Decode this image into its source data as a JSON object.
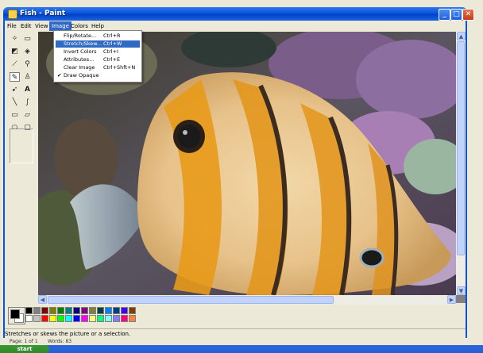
{
  "window": {
    "title": "Fish - Paint"
  },
  "menu": {
    "items": [
      {
        "label": "File"
      },
      {
        "label": "Edit"
      },
      {
        "label": "View"
      },
      {
        "label": "Image",
        "active": true
      },
      {
        "label": "Colors"
      },
      {
        "label": "Help"
      }
    ]
  },
  "image_menu": {
    "items": [
      {
        "label": "Flip/Rotate...",
        "shortcut": "Ctrl+R"
      },
      {
        "label": "Stretch/Skew...",
        "shortcut": "Ctrl+W",
        "highlighted": true
      },
      {
        "label": "Invert Colors",
        "shortcut": "Ctrl+I"
      },
      {
        "label": "Attributes...",
        "shortcut": "Ctrl+E"
      },
      {
        "label": "Clear Image",
        "shortcut": "Ctrl+Shft+N"
      },
      {
        "label": "Draw Opaque",
        "shortcut": "",
        "checked": true
      }
    ],
    "check_mark": "✔"
  },
  "status": {
    "text": "Stretches or skews the picture or a selection."
  },
  "word_status": {
    "page": "Page: 1 of 1",
    "words": "Words: 83"
  },
  "taskbar": {
    "start_label": "start"
  },
  "palette": {
    "primary": "#000000",
    "secondary": "#ffffff",
    "colors": [
      "#000000",
      "#808080",
      "#800000",
      "#808000",
      "#008000",
      "#008080",
      "#000080",
      "#800080",
      "#808040",
      "#004040",
      "#0080ff",
      "#004080",
      "#4000ff",
      "#804000",
      "#ffffff",
      "#c0c0c0",
      "#ff0000",
      "#ffff00",
      "#00ff00",
      "#00ffff",
      "#0000ff",
      "#ff00ff",
      "#ffff80",
      "#00ff80",
      "#80ffff",
      "#8080ff",
      "#ff0080",
      "#ff8040"
    ]
  },
  "tools": {
    "icons": [
      "free-select",
      "rect-select",
      "eraser",
      "fill",
      "picker",
      "magnifier",
      "pencil",
      "brush",
      "airbrush",
      "text",
      "line",
      "curve",
      "rectangle",
      "polygon",
      "ellipse",
      "rounded-rect"
    ]
  }
}
